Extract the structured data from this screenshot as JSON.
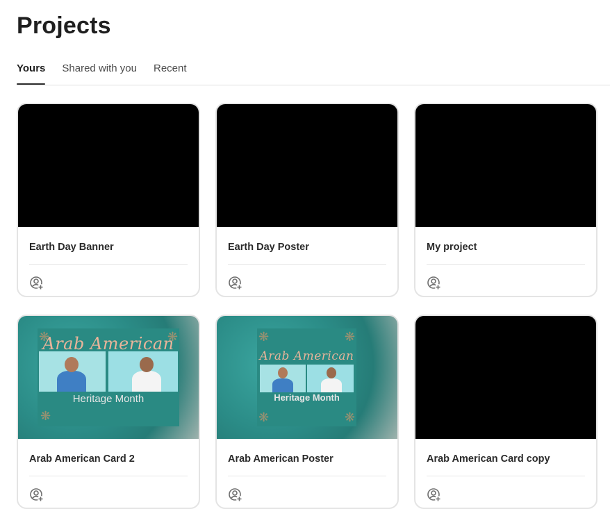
{
  "page": {
    "title": "Projects"
  },
  "tabs": [
    {
      "label": "Yours",
      "active": true
    },
    {
      "label": "Shared with you",
      "active": false
    },
    {
      "label": "Recent",
      "active": false
    }
  ],
  "projects": [
    {
      "title": "Earth Day Banner",
      "thumbnail": "black"
    },
    {
      "title": "Earth Day Poster",
      "thumbnail": "black"
    },
    {
      "title": "My project",
      "thumbnail": "black"
    },
    {
      "title": "Arab American Card 2",
      "thumbnail": "design",
      "design_title": "Arab American",
      "design_subtitle": "Heritage Month"
    },
    {
      "title": "Arab American Poster",
      "thumbnail": "design",
      "design_title": "Arab American",
      "design_subtitle": "Heritage Month"
    },
    {
      "title": "Arab American Card copy",
      "thumbnail": "black"
    }
  ],
  "icons": {
    "share": "invite-user-icon"
  },
  "colors": {
    "teal": "#2b8c87",
    "accent_title": "#e8b49a",
    "tab_underline": "#2c2c2c"
  }
}
